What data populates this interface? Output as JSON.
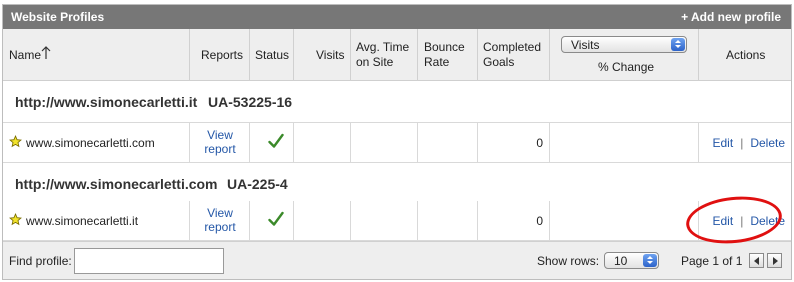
{
  "panel": {
    "title": "Website Profiles",
    "add_label": "+ Add new profile"
  },
  "columns": {
    "name": "Name",
    "reports": "Reports",
    "status": "Status",
    "visits": "Visits",
    "avg_time_1": "Avg. Time",
    "avg_time_2": "on Site",
    "bounce_1": "Bounce",
    "bounce_2": "Rate",
    "goals_1": "Completed",
    "goals_2": "Goals",
    "metric_selected": "Visits",
    "change": "% Change",
    "actions": "Actions"
  },
  "groups": [
    {
      "url": "http://www.simonecarletti.it",
      "ua": "UA-53225-16",
      "profile": {
        "name": "www.simonecarletti.com",
        "view_1": "View",
        "view_2": "report",
        "goals": "0",
        "edit": "Edit",
        "separator": "|",
        "delete": "Delete"
      }
    },
    {
      "url": "http://www.simonecarletti.com",
      "ua": "UA-225-4",
      "profile": {
        "name": "www.simonecarletti.it",
        "view_1": "View",
        "view_2": "report",
        "goals": "0",
        "edit": "Edit",
        "separator": "|",
        "delete": "Delete"
      }
    }
  ],
  "footer": {
    "find_label": "Find profile:",
    "find_value": "",
    "show_rows_label": "Show rows:",
    "show_rows_value": "10",
    "page_label": "Page 1 of 1"
  },
  "icons": {
    "star": "star-icon",
    "status": "checkmark-icon",
    "sort": "sort-arrow-up-icon"
  },
  "colors": {
    "titlebar": "#777777",
    "link": "#2457a7",
    "highlight_circle": "#e01010",
    "check": "#3b8a2a",
    "star": "#f2e32a"
  }
}
